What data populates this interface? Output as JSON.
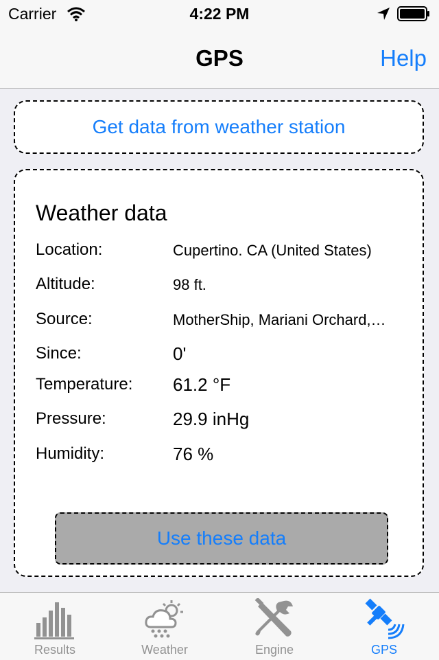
{
  "status_bar": {
    "carrier": "Carrier",
    "time": "4:22 PM"
  },
  "nav": {
    "title": "GPS",
    "help_label": "Help"
  },
  "actions": {
    "get_data_label": "Get data from weather station",
    "use_data_label": "Use these data"
  },
  "weather_card": {
    "title": "Weather data",
    "rows": [
      {
        "label": "Location:",
        "value": "Cupertino. CA (United States)"
      },
      {
        "label": "Altitude:",
        "value": "98 ft."
      },
      {
        "label": "Source:",
        "value": "MotherShip, Mariani Orchard,…"
      },
      {
        "label": "Since:",
        "value": "0'"
      },
      {
        "label": "Temperature:",
        "value": "61.2 °F"
      },
      {
        "label": "Pressure:",
        "value": "29.9 inHg"
      },
      {
        "label": "Humidity:",
        "value": "76 %"
      }
    ]
  },
  "tabs": [
    {
      "label": "Results",
      "icon": "bar-chart-icon",
      "active": false
    },
    {
      "label": "Weather",
      "icon": "weather-icon",
      "active": false
    },
    {
      "label": "Engine",
      "icon": "tools-icon",
      "active": false
    },
    {
      "label": "GPS",
      "icon": "satellite-icon",
      "active": true
    }
  ],
  "colors": {
    "accent": "#157efb",
    "inactive_tab": "#929292",
    "background": "#efeff4",
    "button_gray": "#aaaaaa"
  }
}
